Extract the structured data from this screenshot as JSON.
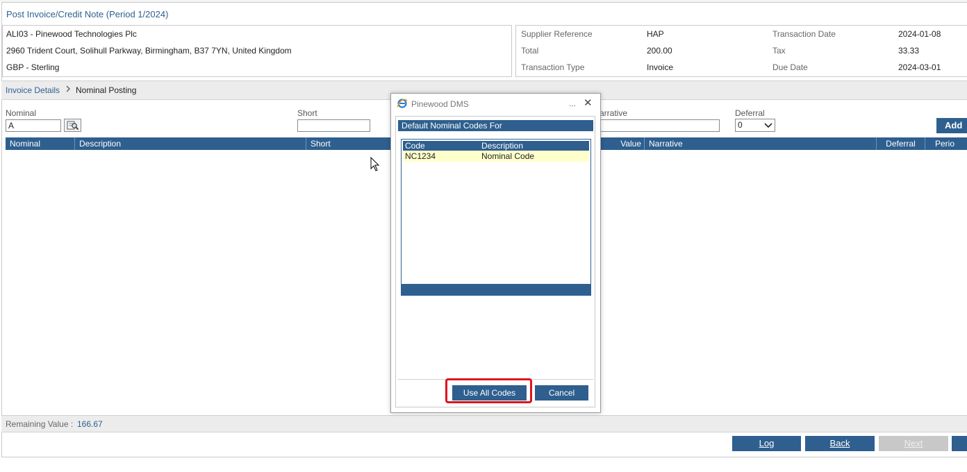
{
  "page": {
    "title": "Post Invoice/Credit Note (Period 1/2024)"
  },
  "supplier": {
    "name": "ALI03 - Pinewood Technologies Plc",
    "address": "2960 Trident Court, Solihull Parkway, Birmingham, B37 7YN, United Kingdom",
    "currency": "GBP - Sterling"
  },
  "summary": {
    "supplier_reference_label": "Supplier Reference",
    "supplier_reference_value": "HAP",
    "transaction_date_label": "Transaction Date",
    "transaction_date_value": "2024-01-08",
    "total_label": "Total",
    "total_value": "200.00",
    "tax_label": "Tax",
    "tax_value": "33.33",
    "transaction_type_label": "Transaction Type",
    "transaction_type_value": "Invoice",
    "due_date_label": "Due Date",
    "due_date_value": "2024-03-01"
  },
  "breadcrumb": {
    "link": "Invoice Details",
    "separator": ">",
    "current": "Nominal Posting"
  },
  "form": {
    "nominal_label": "Nominal",
    "nominal_value": "A",
    "short_label": "Short",
    "short_value": "",
    "narrative_label": "arrative",
    "narrative_value": "",
    "deferral_label": "Deferral",
    "deferral_value": "0",
    "add_label": "Add"
  },
  "table": {
    "columns": [
      "Nominal",
      "Description",
      "Short",
      "Value",
      "Narrative",
      "Deferral",
      "Perio"
    ]
  },
  "remaining": {
    "label": "Remaining Value :",
    "value": "166.67"
  },
  "footer": {
    "log_label": "Log",
    "back_label": "Back",
    "next_label": "Next"
  },
  "dialog": {
    "window_title": "Pinewood DMS",
    "menu_glyph": "...",
    "close_glyph": "✕",
    "heading": "Default Nominal Codes For",
    "columns": [
      "Code",
      "Description"
    ],
    "rows": [
      {
        "code": "NC1234",
        "description": "Nominal Code"
      }
    ],
    "use_all_label": "Use All Codes",
    "cancel_label": "Cancel"
  },
  "colors": {
    "primary": "#2e5f8f",
    "highlight_row": "#ffffcc",
    "annotation": "#e0131b"
  },
  "icons": {
    "lookup": "lookup-icon",
    "window": "ie-icon",
    "cursor": "mouse-pointer-icon"
  }
}
